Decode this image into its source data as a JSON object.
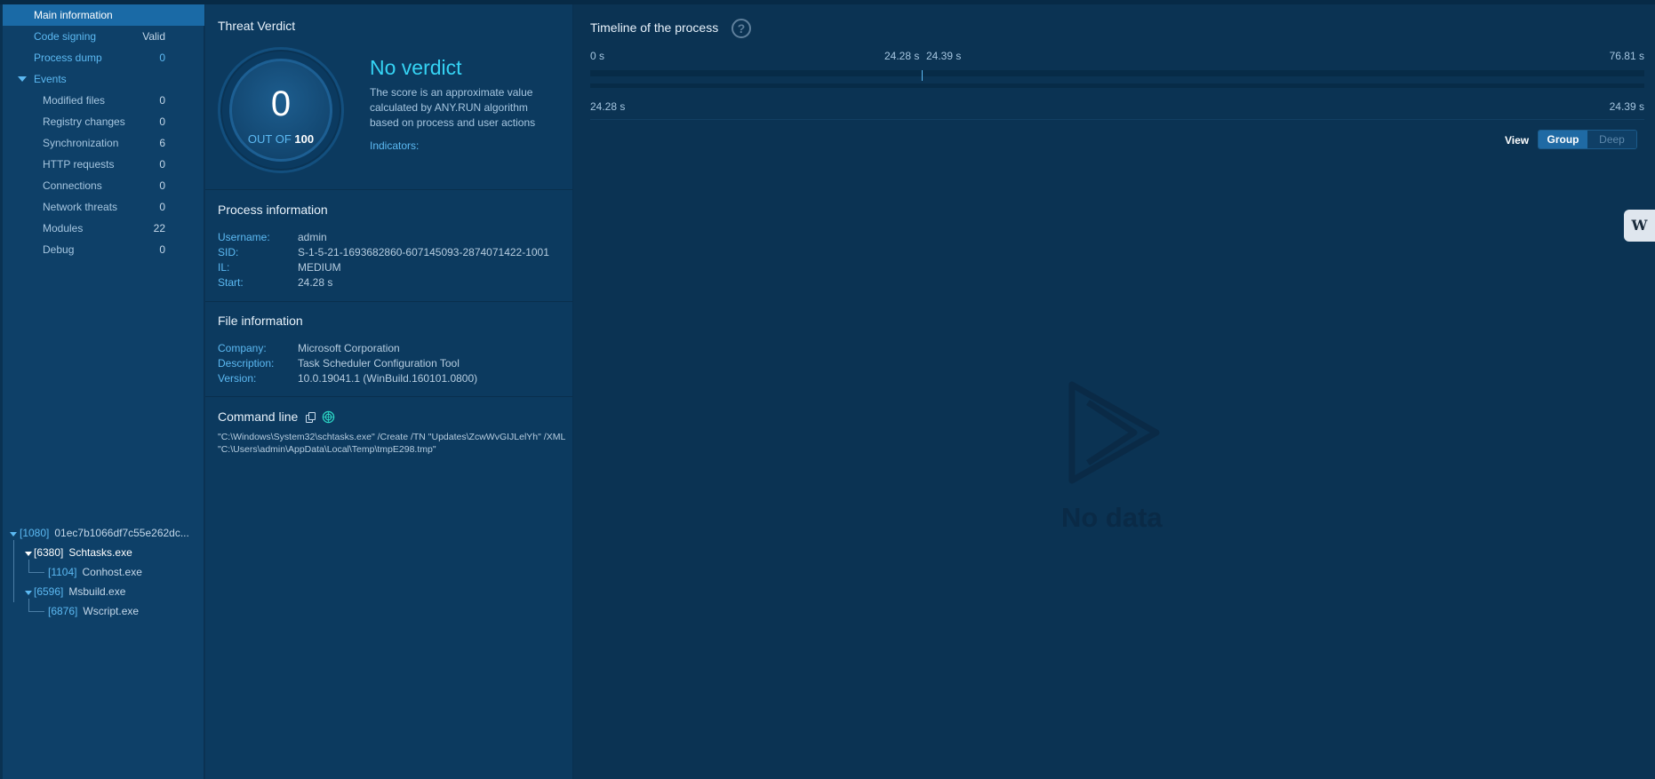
{
  "sidebar": {
    "main_information": "Main information",
    "code_signing": {
      "label": "Code signing",
      "value": "Valid"
    },
    "process_dump": {
      "label": "Process dump",
      "value": "0"
    },
    "events_label": "Events",
    "events": [
      {
        "label": "Modified files",
        "value": "0"
      },
      {
        "label": "Registry changes",
        "value": "0"
      },
      {
        "label": "Synchronization",
        "value": "6"
      },
      {
        "label": "HTTP requests",
        "value": "0"
      },
      {
        "label": "Connections",
        "value": "0"
      },
      {
        "label": "Network threats",
        "value": "0"
      },
      {
        "label": "Modules",
        "value": "22"
      },
      {
        "label": "Debug",
        "value": "0"
      }
    ]
  },
  "process_tree": [
    {
      "pid": "[1080]",
      "name": "01ec7b1066df7c55e262dc..."
    },
    {
      "pid": "[6380]",
      "name": "Schtasks.exe"
    },
    {
      "pid": "[1104]",
      "name": "Conhost.exe"
    },
    {
      "pid": "[6596]",
      "name": "Msbuild.exe"
    },
    {
      "pid": "[6876]",
      "name": "Wscript.exe"
    }
  ],
  "verdict": {
    "title": "Threat Verdict",
    "score": "0",
    "out_of_label": "OUT OF",
    "out_of_value": "100",
    "verdict": "No verdict",
    "description": "The score is an approximate value calculated by ANY.RUN algorithm based on process and user actions",
    "indicators_label": "Indicators:"
  },
  "process_info": {
    "title": "Process information",
    "rows": [
      {
        "k": "Username:",
        "v": "admin"
      },
      {
        "k": "SID:",
        "v": "S-1-5-21-1693682860-607145093-2874071422-1001"
      },
      {
        "k": "IL:",
        "v": "MEDIUM"
      },
      {
        "k": "Start:",
        "v": "24.28 s"
      }
    ]
  },
  "file_info": {
    "title": "File information",
    "rows": [
      {
        "k": "Company:",
        "v": "Microsoft Corporation"
      },
      {
        "k": "Description:",
        "v": "Task Scheduler Configuration Tool"
      },
      {
        "k": "Version:",
        "v": "10.0.19041.1 (WinBuild.160101.0800)"
      }
    ]
  },
  "command_line": {
    "title": "Command line",
    "text": "\"C:\\Windows\\System32\\schtasks.exe\" /Create /TN \"Updates\\ZcwWvGIJLelYh\" /XML \"C:\\Users\\admin\\AppData\\Local\\Temp\\tmpE298.tmp\""
  },
  "timeline": {
    "title": "Timeline of the process",
    "help": "?",
    "start_label": "0 s",
    "proc_start": "24.28 s",
    "proc_end": "24.39 s",
    "end_label": "76.81 s",
    "zoom_start": "24.28 s",
    "zoom_end": "24.39 s",
    "view_label": "View",
    "group_label": "Group",
    "deep_label": "Deep",
    "no_data": "No data"
  },
  "side_badge": "W"
}
